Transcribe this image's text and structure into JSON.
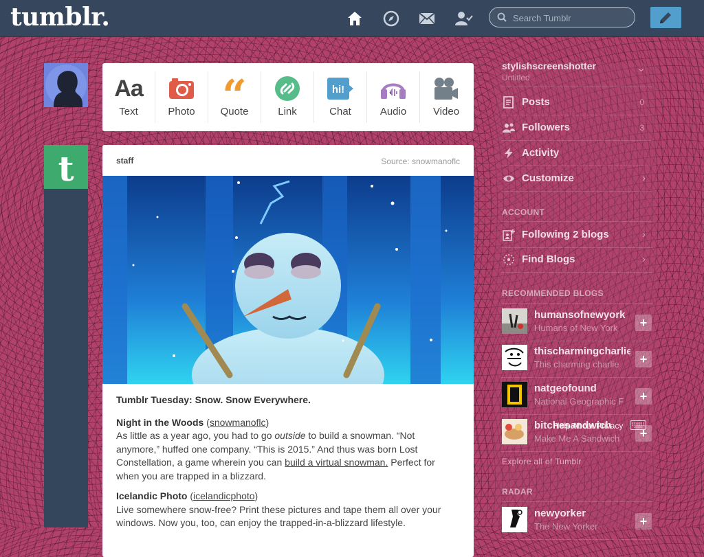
{
  "header": {
    "logo": "tumblr.",
    "search_placeholder": "Search Tumblr",
    "nav_icons": [
      "home-icon",
      "compass-icon",
      "mail-icon",
      "account-icon"
    ],
    "compose_icon": "pencil-icon"
  },
  "post_types": [
    {
      "label": "Text",
      "icon": "text-icon",
      "color": "#444444"
    },
    {
      "label": "Photo",
      "icon": "camera-icon",
      "color": "#e05c48"
    },
    {
      "label": "Quote",
      "icon": "quote-icon",
      "color": "#f2992e"
    },
    {
      "label": "Link",
      "icon": "link-icon",
      "color": "#56bc8a"
    },
    {
      "label": "Chat",
      "icon": "chat-icon",
      "color": "#529ecc"
    },
    {
      "label": "Audio",
      "icon": "headphones-icon",
      "color": "#a77dc2"
    },
    {
      "label": "Video",
      "icon": "video-camera-icon",
      "color": "#748089"
    }
  ],
  "post": {
    "user": "staff",
    "source": "Source: snowmanoflc",
    "title": "Tumblr Tuesday: Snow. Snow Everywhere.",
    "section1_heading": "Night in the Woods",
    "section1_link": "snowmanoflc",
    "section1_text_a": "As little as a year ago, you had to go ",
    "section1_text_em": "outside",
    "section1_text_b": " to build a snowman. “Not anymore,” huffed one company. “This is 2015.” And thus was born Lost Constellation, a game wherein you can ",
    "section1_link2": "build a virtual snowman.",
    "section1_text_c": " Perfect for when you are trapped in a blizzard.",
    "section2_heading": "Icelandic Photo",
    "section2_link": "icelandicphoto",
    "section2_text": "Live somewhere snow-free? Print these pictures and tape them all over your windows. Now you, too, can enjoy the trapped-in-a-blizzard lifestyle."
  },
  "sidebar": {
    "blog_name": "stylishscreenshotter",
    "blog_subtitle": "Untitled",
    "menu": [
      {
        "label": "Posts",
        "count": "0",
        "icon": "posts-icon"
      },
      {
        "label": "Followers",
        "count": "3",
        "icon": "followers-icon"
      },
      {
        "label": "Activity",
        "count": "",
        "icon": "lightning-icon"
      },
      {
        "label": "Customize",
        "count": "",
        "icon": "eye-icon"
      }
    ],
    "account_heading": "ACCOUNT",
    "account_items": [
      {
        "label": "Following 2 blogs",
        "icon": "following-icon"
      },
      {
        "label": "Find Blogs",
        "icon": "find-blogs-icon"
      }
    ],
    "recommended_heading": "RECOMMENDED BLOGS",
    "recommended": [
      {
        "name": "humansofnewyork",
        "sub": "Humans of New York"
      },
      {
        "name": "thischarmingcharlie",
        "sub": "This charming charlie"
      },
      {
        "name": "natgeofound",
        "sub": "National Geographic F"
      },
      {
        "name": "bitchesandwich",
        "sub": "Make Me A Sandwich"
      }
    ],
    "explore": "Explore all of Tumblr",
    "radar_heading": "RADAR",
    "radar": [
      {
        "name": "newyorker",
        "sub": "The New Yorker"
      }
    ],
    "overlay_text": "Help About Privacy"
  }
}
